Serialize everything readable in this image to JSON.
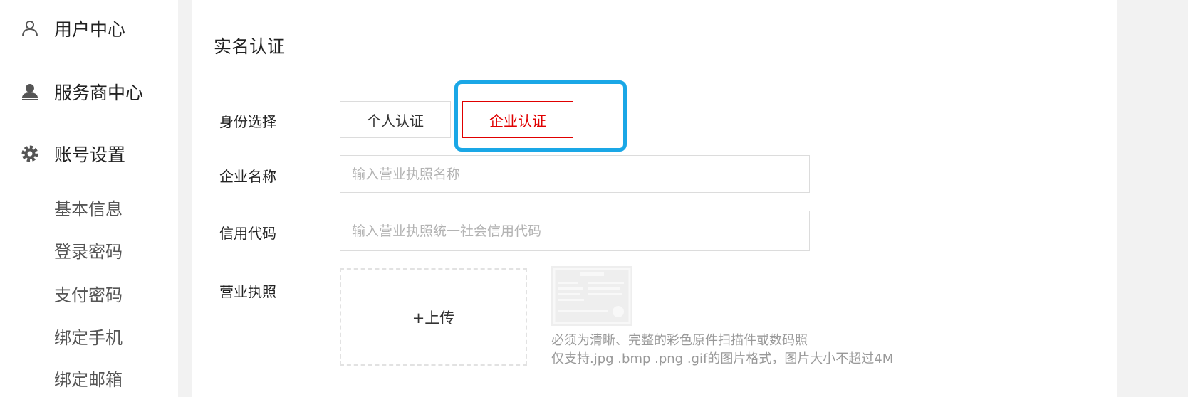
{
  "sidebar": {
    "sections": [
      {
        "label": "用户中心",
        "icon": "user-icon"
      },
      {
        "label": "服务商中心",
        "icon": "provider-icon"
      },
      {
        "label": "账号设置",
        "icon": "gear-icon"
      }
    ],
    "sub_items": [
      {
        "label": "基本信息"
      },
      {
        "label": "登录密码"
      },
      {
        "label": "支付密码"
      },
      {
        "label": "绑定手机"
      },
      {
        "label": "绑定邮箱"
      }
    ]
  },
  "main": {
    "title": "实名认证",
    "identity": {
      "label": "身份选择",
      "options": [
        "个人认证",
        "企业认证"
      ],
      "selected": "企业认证"
    },
    "company_name": {
      "label": "企业名称",
      "value": "",
      "placeholder": "输入营业执照名称"
    },
    "credit_code": {
      "label": "信用代码",
      "value": "",
      "placeholder": "输入营业执照统一社会信用代码"
    },
    "license": {
      "label": "营业执照",
      "upload_label": "+上传",
      "hint_1": "必须为清晰、完整的彩色原件扫描件或数码照",
      "hint_2": "仅支持.jpg .bmp .png .gif的图片格式，图片大小不超过4M"
    }
  },
  "colors": {
    "accent_red": "#e00000",
    "highlight_blue": "#1aa7e6",
    "background": "#f2f2f2"
  }
}
